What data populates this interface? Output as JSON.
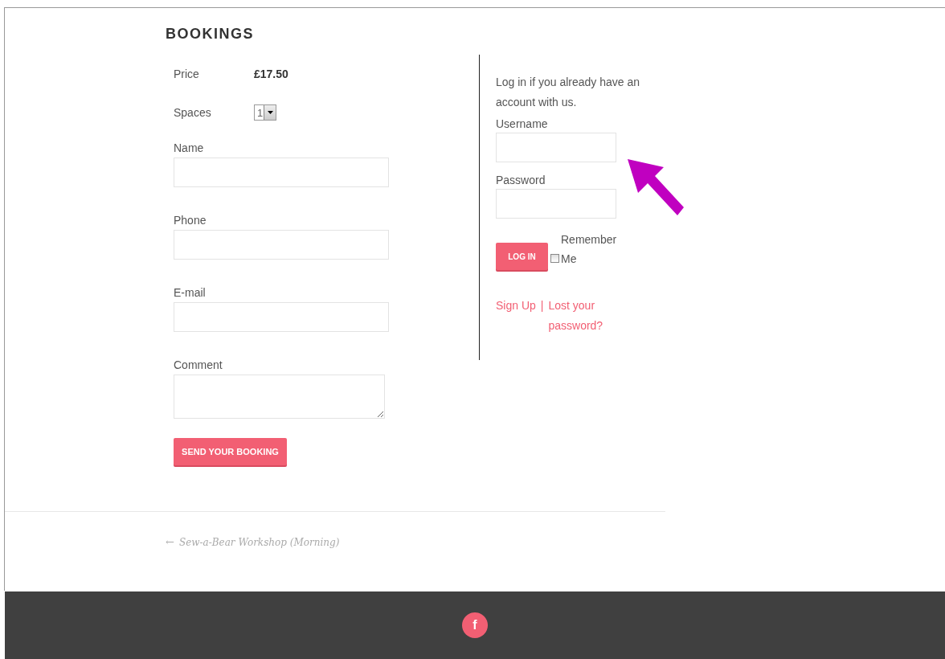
{
  "heading": "BOOKINGS",
  "booking_form": {
    "price": {
      "label": "Price",
      "value": "£17.50"
    },
    "spaces": {
      "label": "Spaces",
      "value": "1"
    },
    "fields": [
      {
        "label": "Name",
        "kind": "input"
      },
      {
        "label": "Phone",
        "kind": "input"
      },
      {
        "label": "E-mail",
        "kind": "input"
      },
      {
        "label": "Comment",
        "kind": "textarea"
      }
    ],
    "submit": "SEND YOUR BOOKING"
  },
  "login": {
    "intro": "Log in if you already have an account with us.",
    "fields": [
      {
        "label": "Username"
      },
      {
        "label": "Password"
      }
    ],
    "button": "LOG IN",
    "remember": {
      "label": "Remember Me",
      "checked": false
    },
    "links": [
      "Sign Up",
      "Lost your password?"
    ],
    "separator": "|"
  },
  "previous_post": {
    "arrow": "←",
    "title": "Sew-a-Bear Workshop (Morning)"
  },
  "footer": {
    "social": [
      "f"
    ]
  }
}
